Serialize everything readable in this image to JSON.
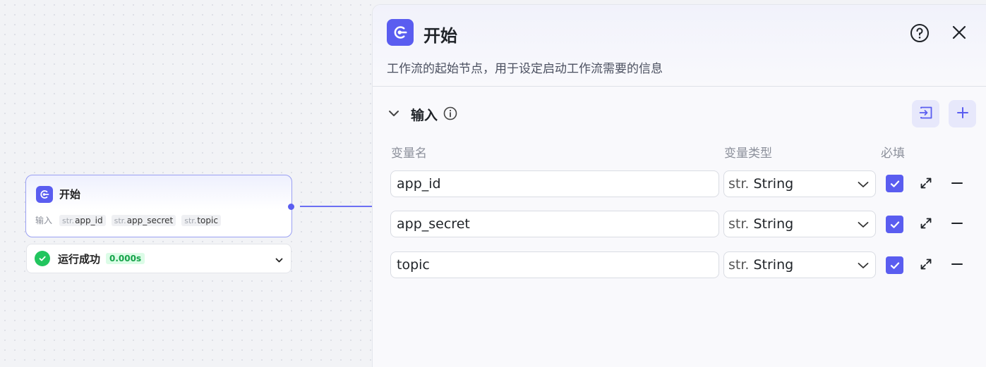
{
  "node": {
    "title": "开始",
    "inputs_label": "输入",
    "inputs": [
      {
        "type": "str.",
        "name": "app_id"
      },
      {
        "type": "str.",
        "name": "app_secret"
      },
      {
        "type": "str.",
        "name": "topic"
      }
    ]
  },
  "run": {
    "label": "运行成功",
    "time": "0.000s"
  },
  "panel": {
    "title": "开始",
    "description": "工作流的起始节点，用于设定启动工作流需要的信息",
    "section_title": "输入",
    "columns": {
      "name": "变量名",
      "type": "变量类型",
      "required": "必填"
    },
    "rows": [
      {
        "name": "app_id",
        "type_prefix": "str.",
        "type_label": "String",
        "required": true
      },
      {
        "name": "app_secret",
        "type_prefix": "str.",
        "type_label": "String",
        "required": true
      },
      {
        "name": "topic",
        "type_prefix": "str.",
        "type_label": "String",
        "required": true
      }
    ]
  },
  "colors": {
    "accent": "#5a5df0",
    "success": "#22c55e",
    "edge": "#6c6ff3"
  },
  "icons": {
    "node": "workflow-start-icon",
    "help": "help-circle-icon",
    "close": "close-icon",
    "collapse": "chevron-down-icon",
    "info": "info-icon",
    "import": "import-icon",
    "add": "plus-icon",
    "expand": "expand-icon",
    "remove": "minus-icon"
  }
}
